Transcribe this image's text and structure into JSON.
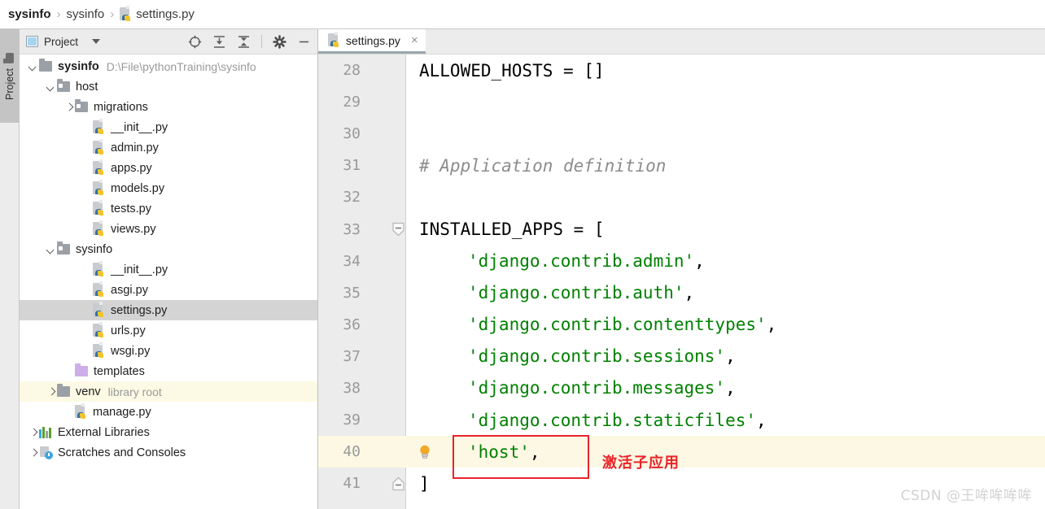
{
  "breadcrumb": {
    "items": [
      {
        "label": "sysinfo",
        "bold": true
      },
      {
        "label": "sysinfo",
        "bold": false
      },
      {
        "label": "settings.py",
        "bold": false,
        "icon": "python-file-icon"
      }
    ],
    "separator": "›"
  },
  "tool_strip": {
    "vertical_tab_label": "Project",
    "folder_icon": "folder-icon"
  },
  "project_panel": {
    "title": "Project",
    "panel_icon": "project-panel-icon",
    "dropdown_icon": "chevron-down-icon",
    "tools": [
      {
        "name": "locate-icon",
        "title": "Select Opened File"
      },
      {
        "name": "expand-all-icon",
        "title": "Expand All"
      },
      {
        "name": "collapse-all-icon",
        "title": "Collapse All"
      },
      {
        "name": "settings-gear-icon",
        "title": "Settings"
      },
      {
        "name": "hide-icon",
        "title": "Hide"
      }
    ],
    "tree": [
      {
        "label": "sysinfo",
        "sub": "D:\\File\\pythonTraining\\sysinfo",
        "indent": 0,
        "arrow": "down",
        "icon": "folder",
        "bold": true,
        "state": "normal"
      },
      {
        "label": "host",
        "sub": "",
        "indent": 1,
        "arrow": "down",
        "icon": "folder-module",
        "bold": false,
        "state": "normal"
      },
      {
        "label": "migrations",
        "sub": "",
        "indent": 2,
        "arrow": "right",
        "icon": "folder-module",
        "bold": false,
        "state": "normal"
      },
      {
        "label": "__init__.py",
        "sub": "",
        "indent": 3,
        "arrow": "none",
        "icon": "python",
        "bold": false,
        "state": "normal"
      },
      {
        "label": "admin.py",
        "sub": "",
        "indent": 3,
        "arrow": "none",
        "icon": "python",
        "bold": false,
        "state": "normal"
      },
      {
        "label": "apps.py",
        "sub": "",
        "indent": 3,
        "arrow": "none",
        "icon": "python",
        "bold": false,
        "state": "normal"
      },
      {
        "label": "models.py",
        "sub": "",
        "indent": 3,
        "arrow": "none",
        "icon": "python",
        "bold": false,
        "state": "normal"
      },
      {
        "label": "tests.py",
        "sub": "",
        "indent": 3,
        "arrow": "none",
        "icon": "python",
        "bold": false,
        "state": "normal"
      },
      {
        "label": "views.py",
        "sub": "",
        "indent": 3,
        "arrow": "none",
        "icon": "python",
        "bold": false,
        "state": "normal"
      },
      {
        "label": "sysinfo",
        "sub": "",
        "indent": 1,
        "arrow": "down",
        "icon": "folder-module",
        "bold": false,
        "state": "normal"
      },
      {
        "label": "__init__.py",
        "sub": "",
        "indent": 3,
        "arrow": "none",
        "icon": "python",
        "bold": false,
        "state": "normal"
      },
      {
        "label": "asgi.py",
        "sub": "",
        "indent": 3,
        "arrow": "none",
        "icon": "python",
        "bold": false,
        "state": "normal"
      },
      {
        "label": "settings.py",
        "sub": "",
        "indent": 3,
        "arrow": "none",
        "icon": "python",
        "bold": false,
        "state": "selected"
      },
      {
        "label": "urls.py",
        "sub": "",
        "indent": 3,
        "arrow": "none",
        "icon": "python",
        "bold": false,
        "state": "normal"
      },
      {
        "label": "wsgi.py",
        "sub": "",
        "indent": 3,
        "arrow": "none",
        "icon": "python",
        "bold": false,
        "state": "normal"
      },
      {
        "label": "templates",
        "sub": "",
        "indent": 2,
        "arrow": "none",
        "icon": "folder-purple",
        "bold": false,
        "state": "normal"
      },
      {
        "label": "venv",
        "sub": "library root",
        "indent": 1,
        "arrow": "right",
        "icon": "folder",
        "bold": false,
        "state": "libroot"
      },
      {
        "label": "manage.py",
        "sub": "",
        "indent": 2,
        "arrow": "none",
        "icon": "python",
        "bold": false,
        "state": "normal"
      },
      {
        "label": "External Libraries",
        "sub": "",
        "indent": 0,
        "arrow": "right",
        "icon": "libraries",
        "bold": false,
        "state": "normal"
      },
      {
        "label": "Scratches and Consoles",
        "sub": "",
        "indent": 0,
        "arrow": "right",
        "icon": "scratches",
        "bold": false,
        "state": "normal"
      }
    ]
  },
  "editor": {
    "tab": {
      "label": "settings.py",
      "icon": "python-file-icon",
      "close": "×"
    },
    "lines": [
      {
        "num": "28",
        "indent": 0,
        "tokens": [
          {
            "t": "ALLOWED_HOSTS = []",
            "c": "kw"
          }
        ],
        "fold": "none",
        "current": false,
        "bulb": false
      },
      {
        "num": "29",
        "indent": 0,
        "tokens": [],
        "fold": "none",
        "current": false,
        "bulb": false
      },
      {
        "num": "30",
        "indent": 0,
        "tokens": [],
        "fold": "none",
        "current": false,
        "bulb": false
      },
      {
        "num": "31",
        "indent": 0,
        "tokens": [
          {
            "t": "# Application definition",
            "c": "cmt"
          }
        ],
        "fold": "none",
        "current": false,
        "bulb": false
      },
      {
        "num": "32",
        "indent": 0,
        "tokens": [],
        "fold": "none",
        "current": false,
        "bulb": false
      },
      {
        "num": "33",
        "indent": 0,
        "tokens": [
          {
            "t": "INSTALLED_APPS = [",
            "c": "kw"
          }
        ],
        "fold": "open",
        "current": false,
        "bulb": false
      },
      {
        "num": "34",
        "indent": 1,
        "tokens": [
          {
            "t": "'django.contrib.admin'",
            "c": "str"
          },
          {
            "t": ",",
            "c": "punct"
          }
        ],
        "fold": "none",
        "current": false,
        "bulb": false
      },
      {
        "num": "35",
        "indent": 1,
        "tokens": [
          {
            "t": "'django.contrib.auth'",
            "c": "str"
          },
          {
            "t": ",",
            "c": "punct"
          }
        ],
        "fold": "none",
        "current": false,
        "bulb": false
      },
      {
        "num": "36",
        "indent": 1,
        "tokens": [
          {
            "t": "'django.contrib.contenttypes'",
            "c": "str"
          },
          {
            "t": ",",
            "c": "punct"
          }
        ],
        "fold": "none",
        "current": false,
        "bulb": false
      },
      {
        "num": "37",
        "indent": 1,
        "tokens": [
          {
            "t": "'django.contrib.sessions'",
            "c": "str"
          },
          {
            "t": ",",
            "c": "punct"
          }
        ],
        "fold": "none",
        "current": false,
        "bulb": false
      },
      {
        "num": "38",
        "indent": 1,
        "tokens": [
          {
            "t": "'django.contrib.messages'",
            "c": "str"
          },
          {
            "t": ",",
            "c": "punct"
          }
        ],
        "fold": "none",
        "current": false,
        "bulb": false
      },
      {
        "num": "39",
        "indent": 1,
        "tokens": [
          {
            "t": "'django.contrib.staticfiles'",
            "c": "str"
          },
          {
            "t": ",",
            "c": "punct"
          }
        ],
        "fold": "none",
        "current": false,
        "bulb": false
      },
      {
        "num": "40",
        "indent": 1,
        "tokens": [
          {
            "t": "'host'",
            "c": "str"
          },
          {
            "t": ",",
            "c": "punct"
          }
        ],
        "fold": "none",
        "current": true,
        "bulb": true
      },
      {
        "num": "41",
        "indent": 0,
        "tokens": [
          {
            "t": "]",
            "c": "kw"
          }
        ],
        "fold": "close",
        "current": false,
        "bulb": false
      }
    ]
  },
  "annotation": {
    "text": "激活子应用",
    "highlight_color": "#e8242a"
  },
  "watermark": {
    "text": "CSDN @王哞哞哞哞"
  }
}
